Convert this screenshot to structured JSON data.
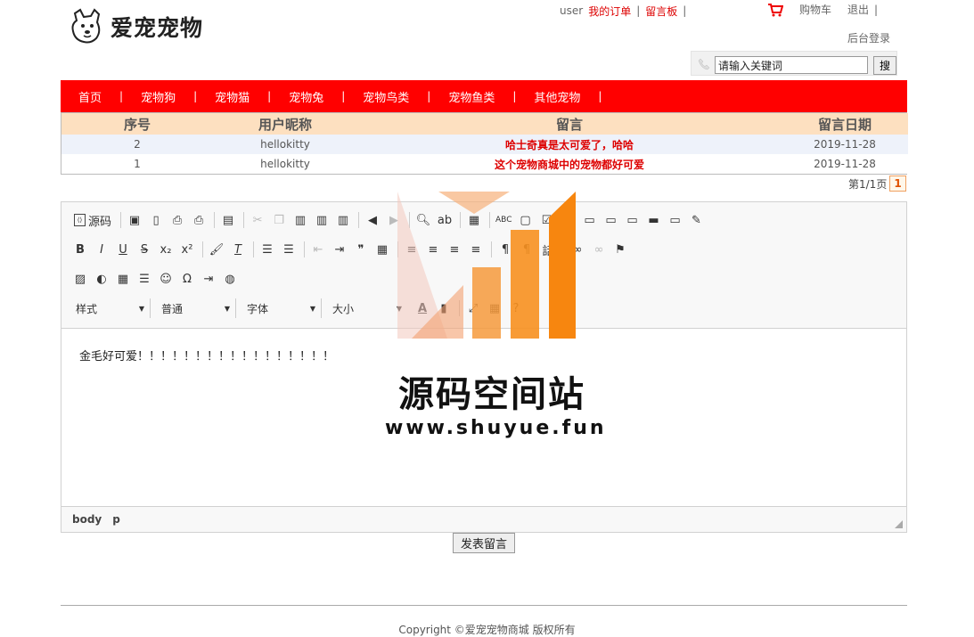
{
  "header": {
    "logo_text": "爱宠宠物",
    "user_label": "user",
    "my_orders": "我的订单",
    "guestbook": "留言板",
    "sep1": "|",
    "sep2": "|",
    "cart": "购物车",
    "logout": "退出",
    "sep3": "|",
    "admin_login": "后台登录"
  },
  "search": {
    "value": "请输入关键词",
    "button": "搜"
  },
  "nav": {
    "items": [
      {
        "label": "首页"
      },
      {
        "label": "宠物狗"
      },
      {
        "label": "宠物猫"
      },
      {
        "label": "宠物兔"
      },
      {
        "label": "宠物鸟类"
      },
      {
        "label": "宠物鱼类"
      },
      {
        "label": "其他宠物"
      }
    ],
    "separator": "|"
  },
  "table": {
    "headers": [
      "序号",
      "用户昵称",
      "留言",
      "留言日期"
    ],
    "rows": [
      {
        "no": "2",
        "user": "hellokitty",
        "message": "哈士奇真是太可爱了，哈哈",
        "date": "2019-11-28"
      },
      {
        "no": "1",
        "user": "hellokitty",
        "message": "这个宠物商城中的宠物都好可爱",
        "date": "2019-11-28"
      }
    ]
  },
  "pager": {
    "text": "第1/1页",
    "current": "1"
  },
  "editor": {
    "source_label": "源码",
    "combos": {
      "style": "样式",
      "format": "普通",
      "font": "字体",
      "size": "大小"
    },
    "content": "金毛好可爱！！！！！！！！！！！！！！！！！",
    "status_path": [
      "body",
      "p"
    ]
  },
  "post_button": "发表留言",
  "footer": {
    "copyright": "Copyright ©爱宠宠物商城 版权所有"
  },
  "watermark": {
    "title": "源码空间站",
    "url": "www.shuyue.fun"
  },
  "colors": {
    "nav_bg": "#ff0000",
    "table_header_bg": "#fde0c0",
    "message_red": "#dd0000",
    "watermark_orange": "#f7860f"
  }
}
